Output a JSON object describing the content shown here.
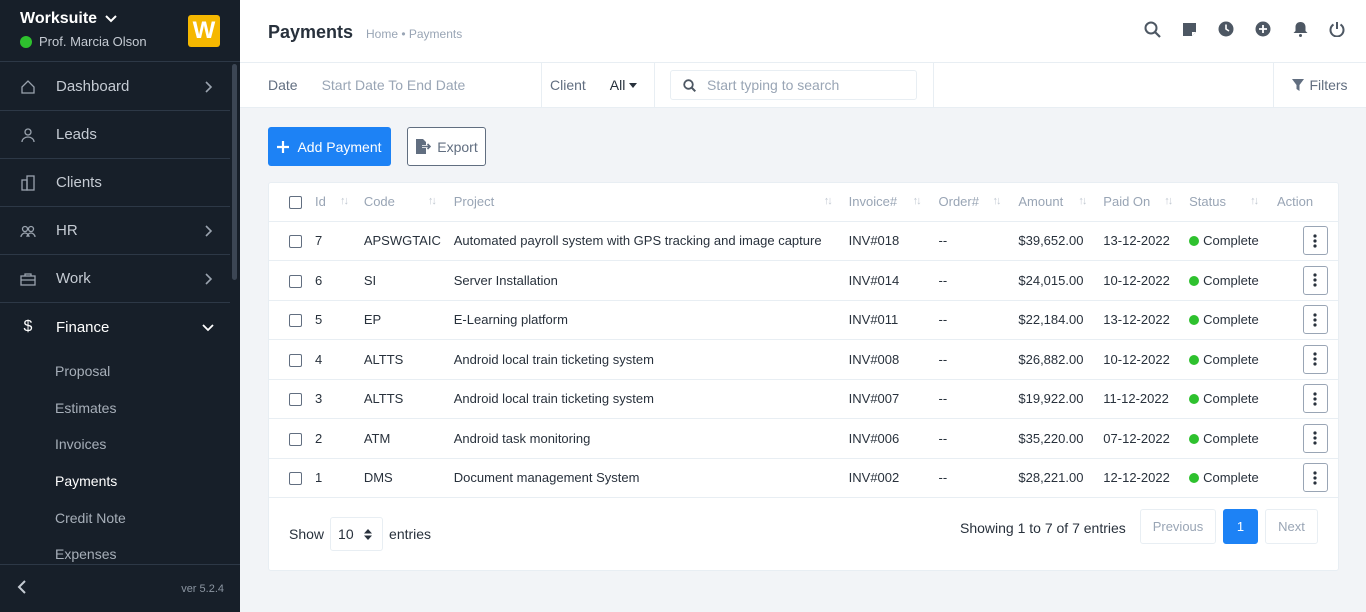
{
  "sidebar": {
    "company": "Worksuite",
    "user": "Prof. Marcia Olson",
    "logo_letter": "W",
    "menu": [
      {
        "label": "Dashboard",
        "icon": "house-icon",
        "chevron": true
      },
      {
        "label": "Leads",
        "icon": "user-icon",
        "chevron": false
      },
      {
        "label": "Clients",
        "icon": "building-icon",
        "chevron": false
      },
      {
        "label": "HR",
        "icon": "people-icon",
        "chevron": true
      },
      {
        "label": "Work",
        "icon": "briefcase-icon",
        "chevron": true
      },
      {
        "label": "Finance",
        "icon": "dollar-icon",
        "chevron": true,
        "expanded": true
      }
    ],
    "finance_submenu": [
      "Proposal",
      "Estimates",
      "Invoices",
      "Payments",
      "Credit Note",
      "Expenses"
    ],
    "active_submenu": "Payments",
    "version": "ver 5.2.4"
  },
  "header": {
    "title": "Payments",
    "breadcrumb": "Home • Payments"
  },
  "filters": {
    "date_label": "Date",
    "date_placeholder": "Start Date To End Date",
    "client_label": "Client",
    "client_value": "All",
    "search_placeholder": "Start typing to search",
    "filters_label": "Filters"
  },
  "actions": {
    "add_label": "Add Payment",
    "export_label": "Export"
  },
  "table": {
    "columns": [
      "Id",
      "Code",
      "Project",
      "Invoice#",
      "Order#",
      "Amount",
      "Paid On",
      "Status",
      "Action"
    ],
    "rows": [
      {
        "id": "7",
        "code": "APSWGTAIC",
        "project": "Automated payroll system with GPS tracking and image capture",
        "invoice": "INV#018",
        "order": "--",
        "amount": "$39,652.00",
        "paid_on": "13-12-2022",
        "status": "Complete"
      },
      {
        "id": "6",
        "code": "SI",
        "project": "Server Installation",
        "invoice": "INV#014",
        "order": "--",
        "amount": "$24,015.00",
        "paid_on": "10-12-2022",
        "status": "Complete"
      },
      {
        "id": "5",
        "code": "EP",
        "project": "E-Learning platform",
        "invoice": "INV#011",
        "order": "--",
        "amount": "$22,184.00",
        "paid_on": "13-12-2022",
        "status": "Complete"
      },
      {
        "id": "4",
        "code": "ALTTS",
        "project": "Android local train ticketing system",
        "invoice": "INV#008",
        "order": "--",
        "amount": "$26,882.00",
        "paid_on": "10-12-2022",
        "status": "Complete"
      },
      {
        "id": "3",
        "code": "ALTTS",
        "project": "Android local train ticketing system",
        "invoice": "INV#007",
        "order": "--",
        "amount": "$19,922.00",
        "paid_on": "11-12-2022",
        "status": "Complete"
      },
      {
        "id": "2",
        "code": "ATM",
        "project": "Android task monitoring",
        "invoice": "INV#006",
        "order": "--",
        "amount": "$35,220.00",
        "paid_on": "07-12-2022",
        "status": "Complete"
      },
      {
        "id": "1",
        "code": "DMS",
        "project": "Document management System",
        "invoice": "INV#002",
        "order": "--",
        "amount": "$28,221.00",
        "paid_on": "12-12-2022",
        "status": "Complete"
      }
    ]
  },
  "footer": {
    "show_label": "Show",
    "page_length": "10",
    "entries_label": "entries",
    "info": "Showing 1 to 7 of 7 entries",
    "prev_label": "Previous",
    "current_page": "1",
    "next_label": "Next"
  },
  "colors": {
    "primary": "#1d82f5",
    "sidebar_bg": "#171f29",
    "status_complete": "#2ec12e",
    "logo": "#f5b700"
  }
}
